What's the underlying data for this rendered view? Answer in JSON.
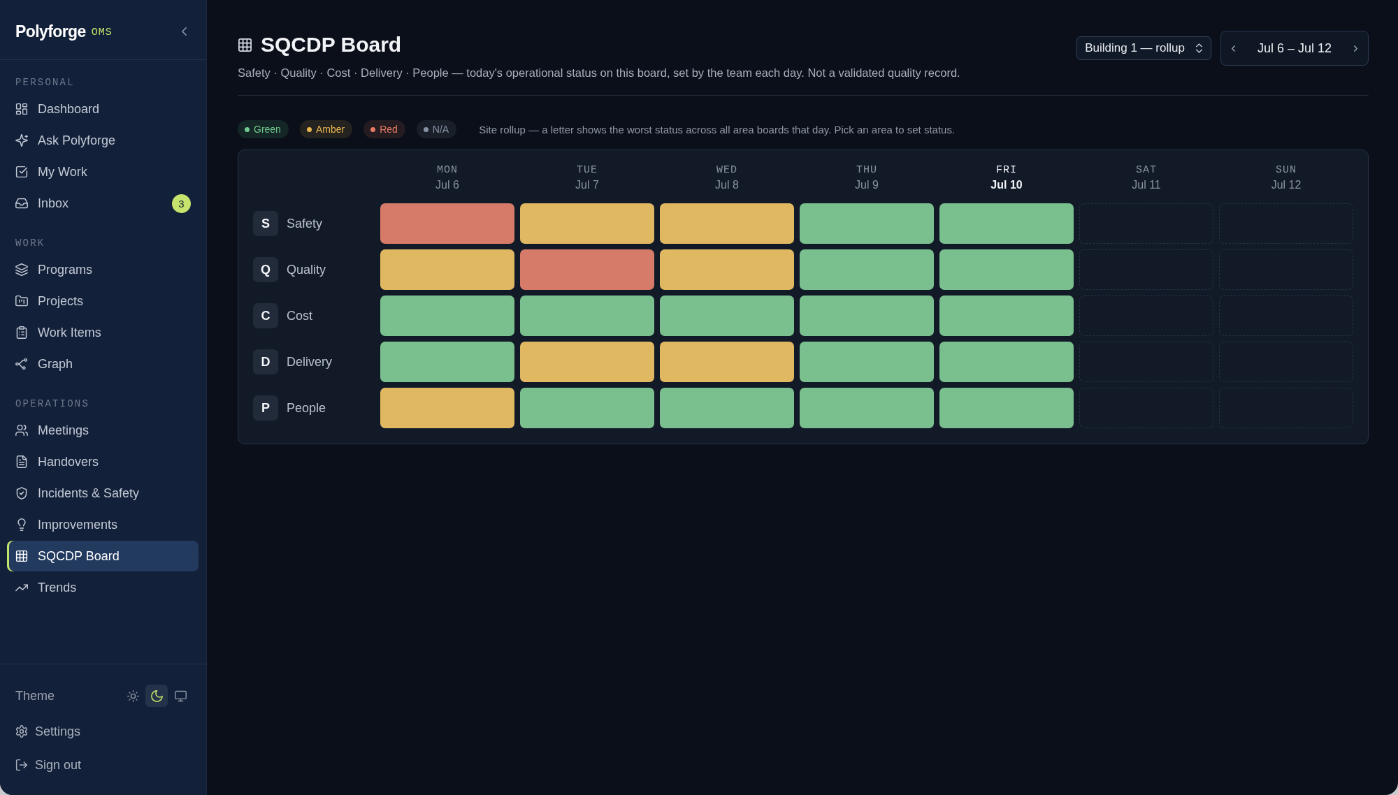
{
  "sidebar": {
    "brand": {
      "name": "Polyforge",
      "suffix": "OMS"
    },
    "sections": [
      {
        "heading": "PERSONAL",
        "items": [
          {
            "label": "Dashboard",
            "selected": false
          },
          {
            "label": "Ask Polyforge",
            "selected": false
          },
          {
            "label": "My Work",
            "selected": false
          },
          {
            "label": "Inbox",
            "badge": "3",
            "selected": false
          }
        ]
      },
      {
        "heading": "WORK",
        "items": [
          {
            "label": "Programs",
            "selected": false
          },
          {
            "label": "Projects",
            "selected": false
          },
          {
            "label": "Work Items",
            "selected": false
          },
          {
            "label": "Graph",
            "selected": false
          }
        ]
      },
      {
        "heading": "OPERATIONS",
        "items": [
          {
            "label": "Meetings",
            "selected": false
          },
          {
            "label": "Handovers",
            "selected": false
          },
          {
            "label": "Incidents & Safety",
            "selected": false
          },
          {
            "label": "Improvements",
            "selected": false
          },
          {
            "label": "SQCDP Board",
            "selected": true
          },
          {
            "label": "Trends",
            "selected": false
          }
        ]
      }
    ],
    "theme": {
      "label": "Theme",
      "options": [
        {
          "kind": "light",
          "selected": false
        },
        {
          "kind": "dark",
          "selected": true
        },
        {
          "kind": "system",
          "selected": false
        }
      ]
    },
    "footer_items": [
      {
        "label": "Settings"
      },
      {
        "label": "Sign out"
      }
    ]
  },
  "header": {
    "title": "SQCDP Board",
    "subtitle": "Safety · Quality · Cost · Delivery · People — today's operational status on this board, set by the team each day. Not a validated quality record.",
    "site_select": {
      "value": "Building 1 — rollup"
    },
    "date_range": {
      "label": "Jul 6 – Jul 12"
    }
  },
  "legend": {
    "items": [
      {
        "label": "Green",
        "color": "#6fcb8f"
      },
      {
        "label": "Amber",
        "color": "#e8b64f"
      },
      {
        "label": "Red",
        "color": "#e87b64"
      },
      {
        "label": "N/A",
        "color": "#8792a5"
      }
    ],
    "note": "Site rollup — a letter shows the worst status across all area boards that day. Pick an area to set status."
  },
  "board": {
    "days": [
      {
        "day": "MON",
        "date": "Jul 6",
        "today": false
      },
      {
        "day": "TUE",
        "date": "Jul 7",
        "today": false
      },
      {
        "day": "WED",
        "date": "Jul 8",
        "today": false
      },
      {
        "day": "THU",
        "date": "Jul 9",
        "today": false
      },
      {
        "day": "FRI",
        "date": "Jul 10",
        "today": true
      },
      {
        "day": "SAT",
        "date": "Jul 11",
        "today": false
      },
      {
        "day": "SUN",
        "date": "Jul 12",
        "today": false
      }
    ],
    "rows": [
      {
        "letter": "S",
        "label": "Safety",
        "cells": [
          {
            "kind": "filled",
            "color": "#d67b69"
          },
          {
            "kind": "filled",
            "color": "#e1b862"
          },
          {
            "kind": "filled",
            "color": "#e1b862"
          },
          {
            "kind": "filled",
            "color": "#7abf8e"
          },
          {
            "kind": "filled",
            "color": "#7abf8e"
          },
          {
            "kind": "empty"
          },
          {
            "kind": "empty"
          }
        ]
      },
      {
        "letter": "Q",
        "label": "Quality",
        "cells": [
          {
            "kind": "filled",
            "color": "#e1b862"
          },
          {
            "kind": "filled",
            "color": "#d67b69"
          },
          {
            "kind": "filled",
            "color": "#e1b862"
          },
          {
            "kind": "filled",
            "color": "#7abf8e"
          },
          {
            "kind": "filled",
            "color": "#7abf8e"
          },
          {
            "kind": "empty"
          },
          {
            "kind": "empty"
          }
        ]
      },
      {
        "letter": "C",
        "label": "Cost",
        "cells": [
          {
            "kind": "filled",
            "color": "#7abf8e"
          },
          {
            "kind": "filled",
            "color": "#7abf8e"
          },
          {
            "kind": "filled",
            "color": "#7abf8e"
          },
          {
            "kind": "filled",
            "color": "#7abf8e"
          },
          {
            "kind": "filled",
            "color": "#7abf8e"
          },
          {
            "kind": "empty"
          },
          {
            "kind": "empty"
          }
        ]
      },
      {
        "letter": "D",
        "label": "Delivery",
        "cells": [
          {
            "kind": "filled",
            "color": "#7abf8e"
          },
          {
            "kind": "filled",
            "color": "#e1b862"
          },
          {
            "kind": "filled",
            "color": "#e1b862"
          },
          {
            "kind": "filled",
            "color": "#7abf8e"
          },
          {
            "kind": "filled",
            "color": "#7abf8e"
          },
          {
            "kind": "empty"
          },
          {
            "kind": "empty"
          }
        ]
      },
      {
        "letter": "P",
        "label": "People",
        "cells": [
          {
            "kind": "filled",
            "color": "#e1b862"
          },
          {
            "kind": "filled",
            "color": "#7abf8e"
          },
          {
            "kind": "filled",
            "color": "#7abf8e"
          },
          {
            "kind": "filled",
            "color": "#7abf8e"
          },
          {
            "kind": "filled",
            "color": "#7abf8e"
          },
          {
            "kind": "empty"
          },
          {
            "kind": "empty"
          }
        ]
      }
    ]
  }
}
